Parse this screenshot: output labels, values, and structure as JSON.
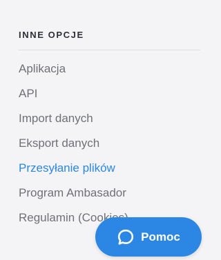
{
  "section": {
    "title": "INNE OPCJE",
    "items": [
      {
        "label": "Aplikacja"
      },
      {
        "label": "API"
      },
      {
        "label": "Import danych"
      },
      {
        "label": "Eksport danych"
      },
      {
        "label": "Przesyłanie plików"
      },
      {
        "label": "Program Ambasador"
      },
      {
        "label": "Regulamin (Cookies)"
      }
    ],
    "active_item": "Przesyłanie plików"
  },
  "help_button": {
    "label": "Pomoc",
    "icon": "chat-bubble-icon"
  },
  "colors": {
    "background": "#f4f4f6",
    "accent": "#2b87e3",
    "text_muted": "#6f7176",
    "heading": "#2b2f36"
  }
}
